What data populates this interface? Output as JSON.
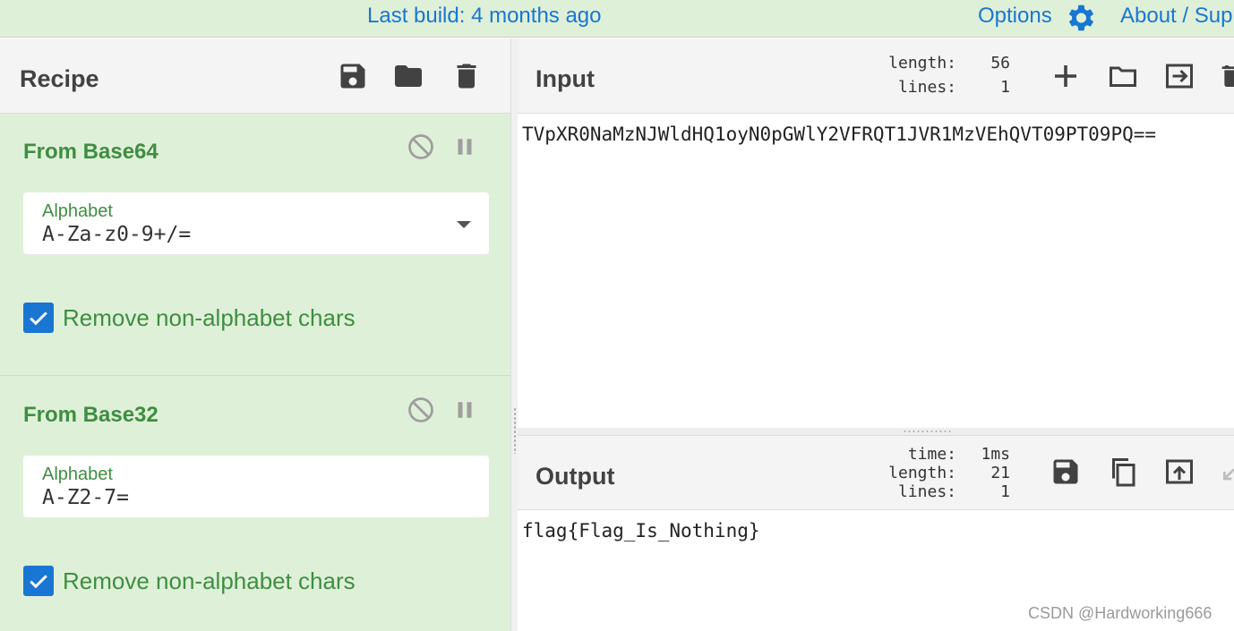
{
  "banner": {
    "build_text": "Last build: 4 months ago",
    "options_label": "Options",
    "about_label": "About / Support",
    "gear_icon": "gear-icon",
    "link_color": "#1976d2"
  },
  "recipe": {
    "title": "Recipe",
    "icons": [
      "save-icon",
      "folder-icon",
      "trash-icon"
    ],
    "operations": [
      {
        "name": "From Base64",
        "field_label": "Alphabet",
        "field_value": "A-Za-z0-9+/=",
        "has_dropdown": true,
        "checkbox_label": "Remove non-alphabet chars",
        "checked": true
      },
      {
        "name": "From Base32",
        "field_label": "Alphabet",
        "field_value": "A-Z2-7=",
        "has_dropdown": false,
        "checkbox_label": "Remove non-alphabet chars",
        "checked": true
      }
    ]
  },
  "input": {
    "title": "Input",
    "length_key": "length:",
    "length_value": "56",
    "lines_key": "lines:",
    "lines_value": "1",
    "text": "TVpXR0NaMzNJWldHQ1oyN0pGWlY2VFRQT1JVR1MzVEhQVT09PT09PQ=="
  },
  "output": {
    "title": "Output",
    "time_key": "time:",
    "time_value": "1ms",
    "length_key": "length:",
    "length_value": "21",
    "lines_key": "lines:",
    "lines_value": "1",
    "text": "flag{Flag_Is_Nothing}"
  },
  "watermark": "CSDN @Hardworking666",
  "colors": {
    "recipe_bg": "#dff0d8",
    "op_title": "#3e8e41",
    "checkbox": "#1976d2"
  }
}
